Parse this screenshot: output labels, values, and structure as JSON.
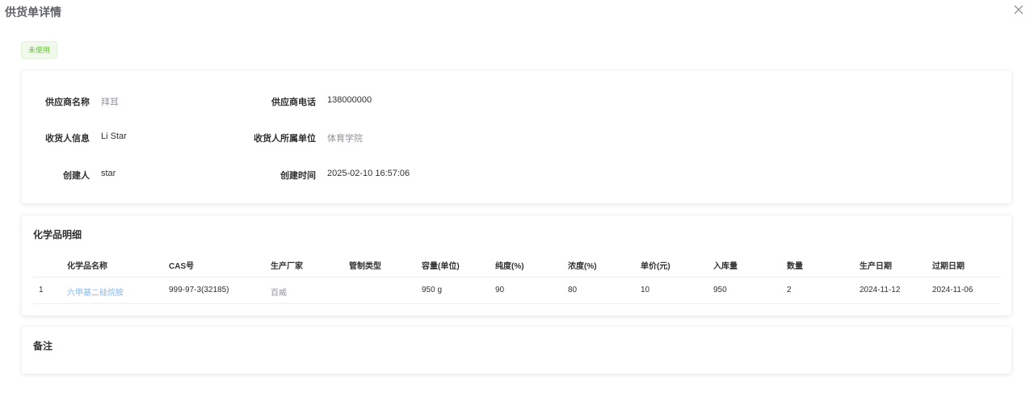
{
  "modal": {
    "title": "供货单详情",
    "close_icon": "close-icon"
  },
  "status": {
    "label": "未使用",
    "color": "#67c23a"
  },
  "info": {
    "supplier_name_label": "供应商名称",
    "supplier_name": "拜耳",
    "supplier_phone_label": "供应商电话",
    "supplier_phone": "138000000",
    "receiver_label": "收货人信息",
    "receiver": "Li Star",
    "receiver_unit_label": "收货人所属单位",
    "receiver_unit": "体育学院",
    "creator_label": "创建人",
    "creator": "star",
    "created_time_label": "创建时间",
    "created_time": "2025-02-10 16:57:06"
  },
  "chemicals": {
    "title": "化学品明细",
    "columns": [
      "化学品名称",
      "CAS号",
      "生产厂家",
      "管制类型",
      "容量(单位)",
      "纯度(%)",
      "浓度(%)",
      "单价(元)",
      "入库量",
      "数量",
      "生产日期",
      "过期日期"
    ],
    "rows": [
      [
        "1",
        "六甲基二硅烷胺",
        "999-97-3(32185)",
        "百威",
        "",
        "950 g",
        "90",
        "80",
        "10",
        "950",
        "2",
        "2024-11-12",
        "2024-11-06"
      ]
    ]
  },
  "remark": {
    "title": "备注"
  }
}
